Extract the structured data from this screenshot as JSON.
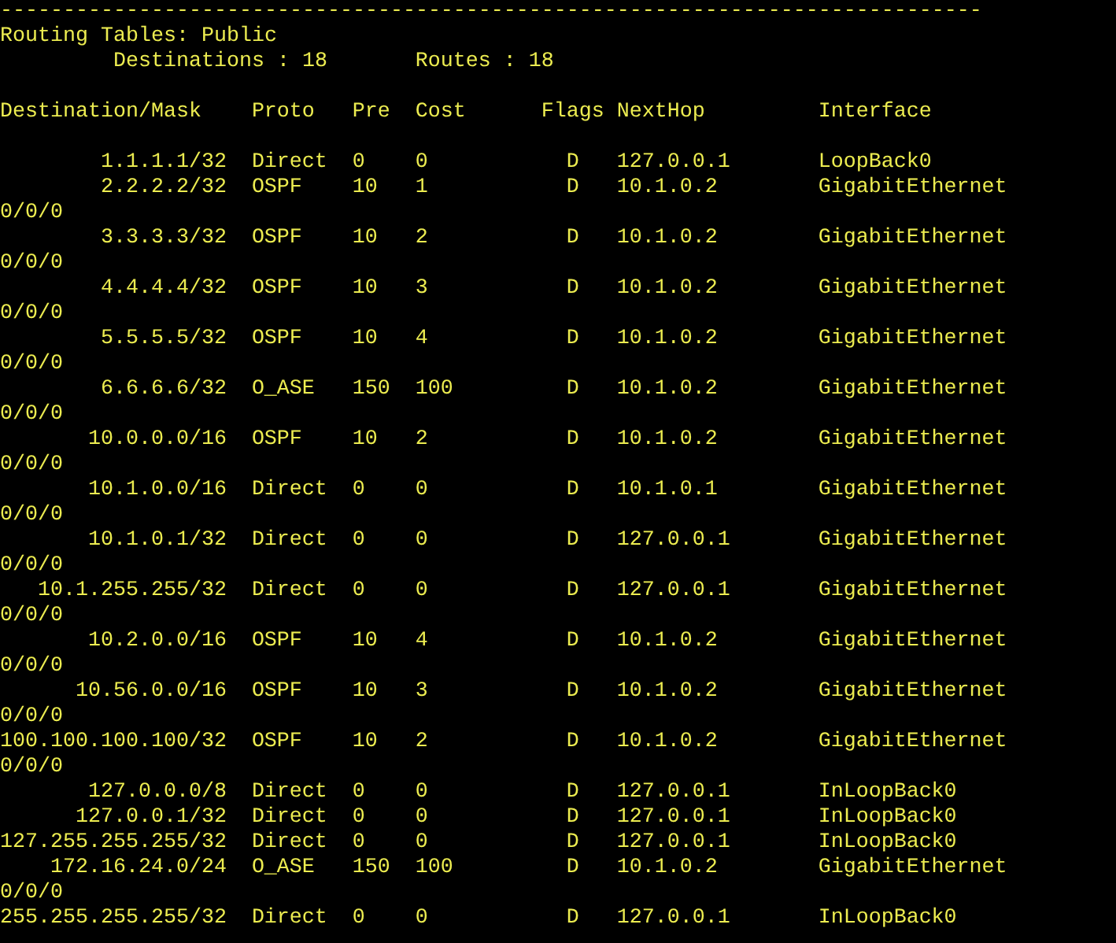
{
  "separator": "------------------------------------------------------------------------------",
  "title": "Routing Tables: Public",
  "summary": [
    "Destinations : 18",
    "Routes : 18"
  ],
  "columns": [
    "Destination/Mask",
    "Proto",
    "Pre",
    "Cost",
    "Flags",
    "NextHop",
    "Interface"
  ],
  "rows": [
    {
      "destination": "1.1.1.1/32",
      "proto": "Direct",
      "pre": "0",
      "cost": "0",
      "flags": "D",
      "nexthop": "127.0.0.1",
      "interface": "LoopBack0"
    },
    {
      "destination": "2.2.2.2/32",
      "proto": "OSPF",
      "pre": "10",
      "cost": "1",
      "flags": "D",
      "nexthop": "10.1.0.2",
      "interface": "GigabitEthernet",
      "interface_wrap": "0/0/0"
    },
    {
      "destination": "3.3.3.3/32",
      "proto": "OSPF",
      "pre": "10",
      "cost": "2",
      "flags": "D",
      "nexthop": "10.1.0.2",
      "interface": "GigabitEthernet",
      "interface_wrap": "0/0/0"
    },
    {
      "destination": "4.4.4.4/32",
      "proto": "OSPF",
      "pre": "10",
      "cost": "3",
      "flags": "D",
      "nexthop": "10.1.0.2",
      "interface": "GigabitEthernet",
      "interface_wrap": "0/0/0"
    },
    {
      "destination": "5.5.5.5/32",
      "proto": "OSPF",
      "pre": "10",
      "cost": "4",
      "flags": "D",
      "nexthop": "10.1.0.2",
      "interface": "GigabitEthernet",
      "interface_wrap": "0/0/0"
    },
    {
      "destination": "6.6.6.6/32",
      "proto": "O_ASE",
      "pre": "150",
      "cost": "100",
      "flags": "D",
      "nexthop": "10.1.0.2",
      "interface": "GigabitEthernet",
      "interface_wrap": "0/0/0"
    },
    {
      "destination": "10.0.0.0/16",
      "proto": "OSPF",
      "pre": "10",
      "cost": "2",
      "flags": "D",
      "nexthop": "10.1.0.2",
      "interface": "GigabitEthernet",
      "interface_wrap": "0/0/0"
    },
    {
      "destination": "10.1.0.0/16",
      "proto": "Direct",
      "pre": "0",
      "cost": "0",
      "flags": "D",
      "nexthop": "10.1.0.1",
      "interface": "GigabitEthernet",
      "interface_wrap": "0/0/0"
    },
    {
      "destination": "10.1.0.1/32",
      "proto": "Direct",
      "pre": "0",
      "cost": "0",
      "flags": "D",
      "nexthop": "127.0.0.1",
      "interface": "GigabitEthernet",
      "interface_wrap": "0/0/0"
    },
    {
      "destination": "10.1.255.255/32",
      "proto": "Direct",
      "pre": "0",
      "cost": "0",
      "flags": "D",
      "nexthop": "127.0.0.1",
      "interface": "GigabitEthernet",
      "interface_wrap": "0/0/0"
    },
    {
      "destination": "10.2.0.0/16",
      "proto": "OSPF",
      "pre": "10",
      "cost": "4",
      "flags": "D",
      "nexthop": "10.1.0.2",
      "interface": "GigabitEthernet",
      "interface_wrap": "0/0/0"
    },
    {
      "destination": "10.56.0.0/16",
      "proto": "OSPF",
      "pre": "10",
      "cost": "3",
      "flags": "D",
      "nexthop": "10.1.0.2",
      "interface": "GigabitEthernet",
      "interface_wrap": "0/0/0"
    },
    {
      "destination": "100.100.100.100/32",
      "proto": "OSPF",
      "pre": "10",
      "cost": "2",
      "flags": "D",
      "nexthop": "10.1.0.2",
      "interface": "GigabitEthernet",
      "interface_wrap": "0/0/0"
    },
    {
      "destination": "127.0.0.0/8",
      "proto": "Direct",
      "pre": "0",
      "cost": "0",
      "flags": "D",
      "nexthop": "127.0.0.1",
      "interface": "InLoopBack0"
    },
    {
      "destination": "127.0.0.1/32",
      "proto": "Direct",
      "pre": "0",
      "cost": "0",
      "flags": "D",
      "nexthop": "127.0.0.1",
      "interface": "InLoopBack0"
    },
    {
      "destination": "127.255.255.255/32",
      "proto": "Direct",
      "pre": "0",
      "cost": "0",
      "flags": "D",
      "nexthop": "127.0.0.1",
      "interface": "InLoopBack0"
    },
    {
      "destination": "172.16.24.0/24",
      "proto": "O_ASE",
      "pre": "150",
      "cost": "100",
      "flags": "D",
      "nexthop": "10.1.0.2",
      "interface": "GigabitEthernet",
      "interface_wrap": "0/0/0"
    },
    {
      "destination": "255.255.255.255/32",
      "proto": "Direct",
      "pre": "0",
      "cost": "0",
      "flags": "D",
      "nexthop": "127.0.0.1",
      "interface": "InLoopBack0"
    }
  ]
}
